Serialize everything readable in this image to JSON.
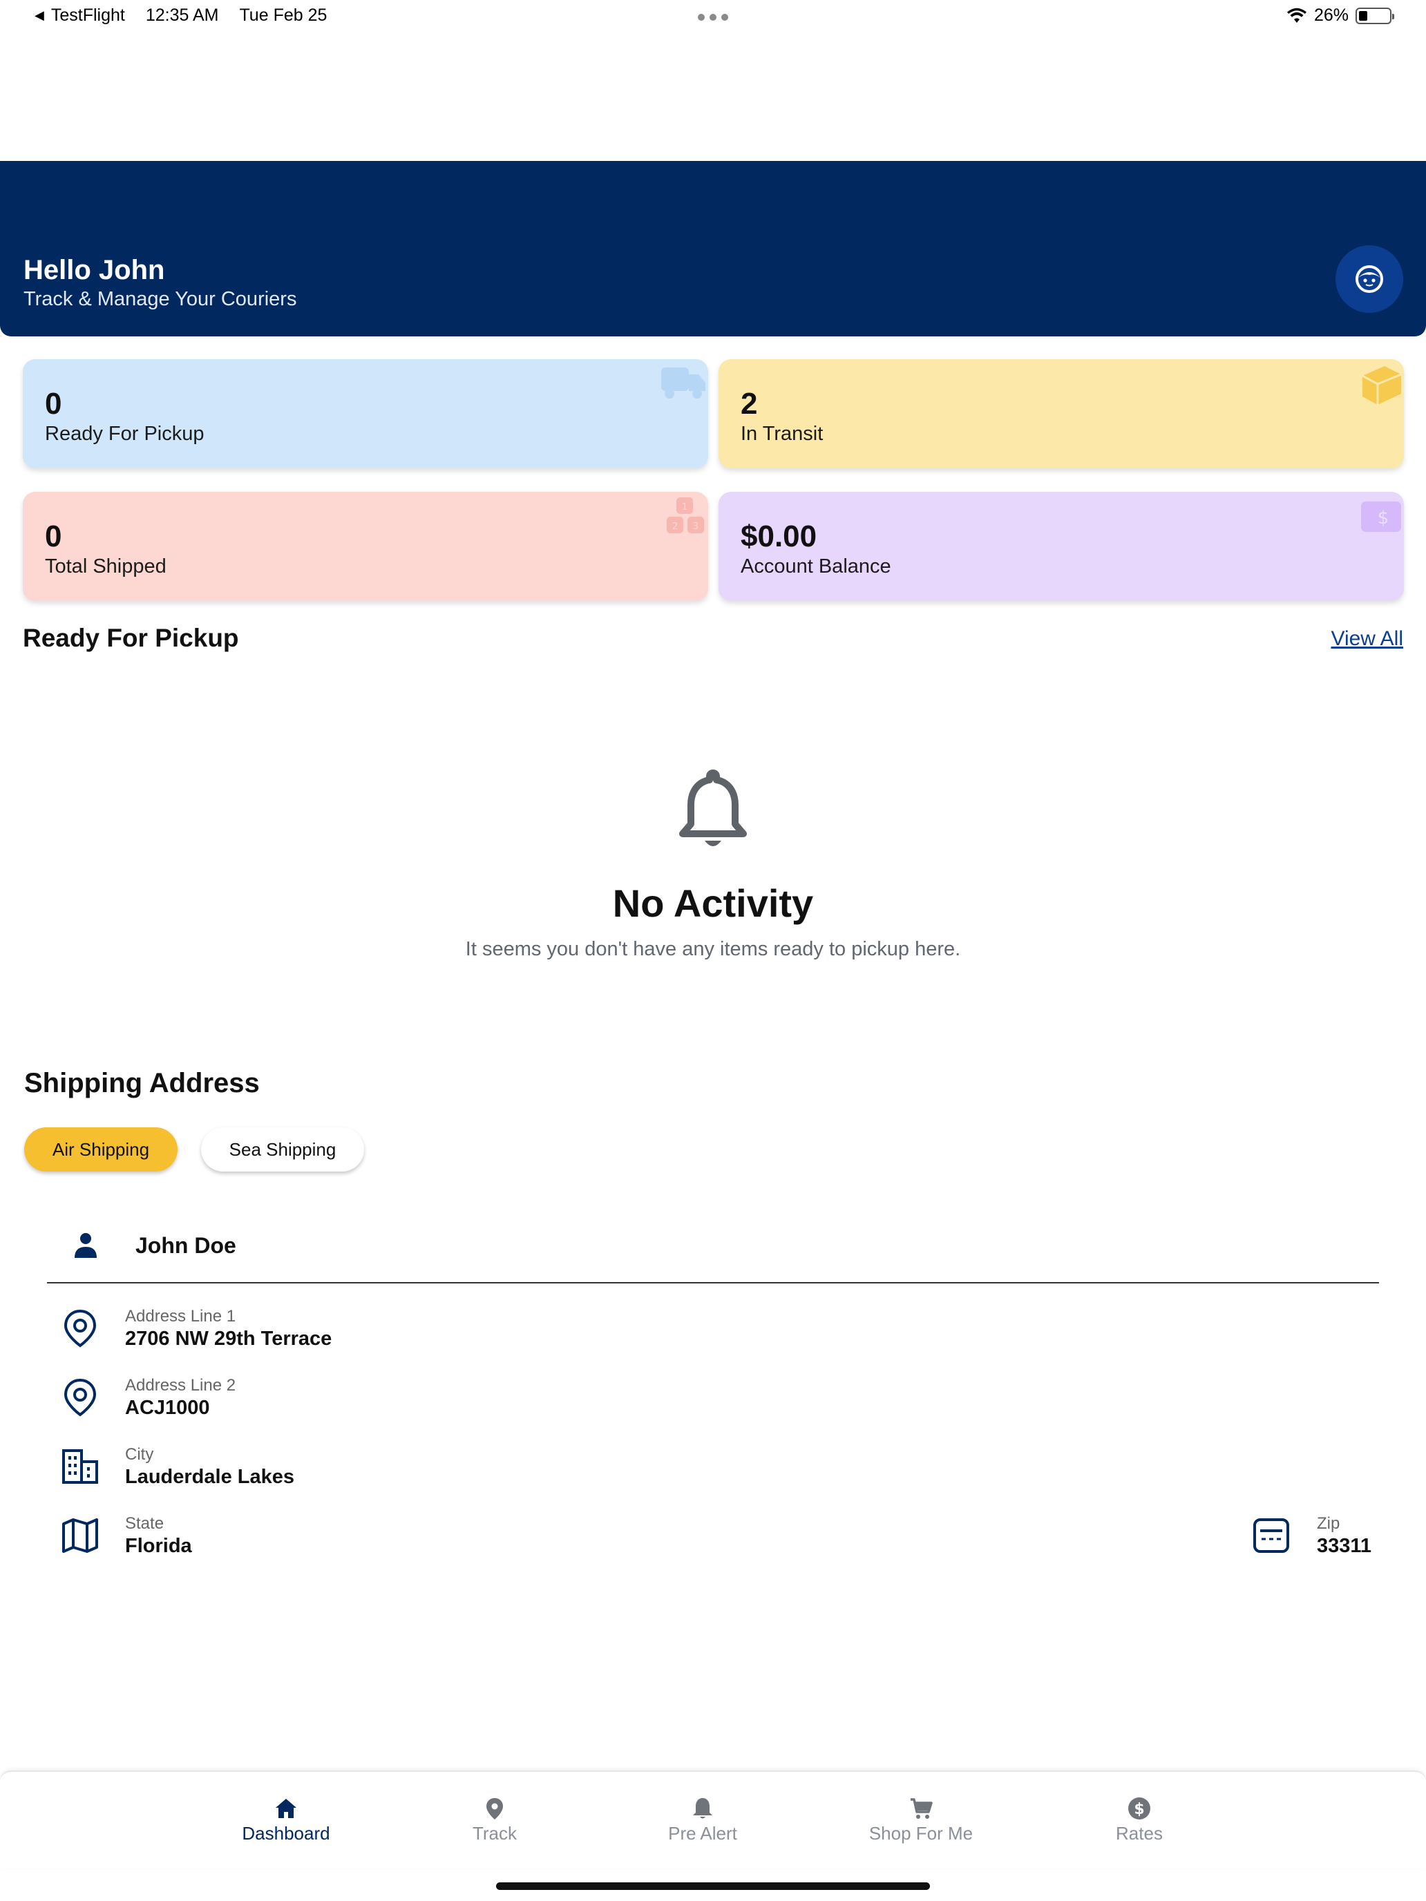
{
  "status_bar": {
    "back_app": "TestFlight",
    "time": "12:35 AM",
    "date": "Tue Feb 25",
    "battery": "26%"
  },
  "header": {
    "greeting": "Hello John",
    "subtitle": "Track & Manage Your Couriers",
    "bg_color": "#022860"
  },
  "stats": [
    {
      "value": "0",
      "label": "Ready For Pickup",
      "color": "#d0e6fb",
      "icon": "truck-icon"
    },
    {
      "value": "2",
      "label": "In Transit",
      "color": "#fce8a8",
      "icon": "package-icon"
    },
    {
      "value": "0",
      "label": "Total Shipped",
      "color": "#fdd7d2",
      "icon": "boxes-icon"
    },
    {
      "value": "$0.00",
      "label": "Account Balance",
      "color": "#e8d7fd",
      "icon": "dollar-card-icon"
    }
  ],
  "ready_section": {
    "title": "Ready For Pickup",
    "view_all": "View All"
  },
  "empty_state": {
    "icon": "bell-icon",
    "title": "No Activity",
    "text": "It seems you don't have any items ready to pickup here."
  },
  "shipping": {
    "title": "Shipping Address",
    "tabs": [
      {
        "label": "Air Shipping",
        "selected": true
      },
      {
        "label": "Sea Shipping",
        "selected": false
      }
    ],
    "name": "John Doe",
    "fields": {
      "address1": {
        "label": "Address Line 1",
        "value": "2706 NW 29th Terrace"
      },
      "address2": {
        "label": "Address Line 2",
        "value": "ACJ1000"
      },
      "city": {
        "label": "City",
        "value": "Lauderdale Lakes"
      },
      "state": {
        "label": "State",
        "value": "Florida"
      },
      "zip": {
        "label": "Zip",
        "value": "33311"
      }
    }
  },
  "nav": {
    "items": [
      {
        "label": "Dashboard",
        "icon": "home-icon",
        "active": true
      },
      {
        "label": "Track",
        "icon": "location-pin-icon",
        "active": false
      },
      {
        "label": "Pre Alert",
        "icon": "bell-icon",
        "active": false
      },
      {
        "label": "Shop For Me",
        "icon": "cart-icon",
        "active": false
      },
      {
        "label": "Rates",
        "icon": "dollar-icon",
        "active": false
      }
    ]
  },
  "colors": {
    "accent": "#f6bf2f",
    "brand": "#022860"
  }
}
